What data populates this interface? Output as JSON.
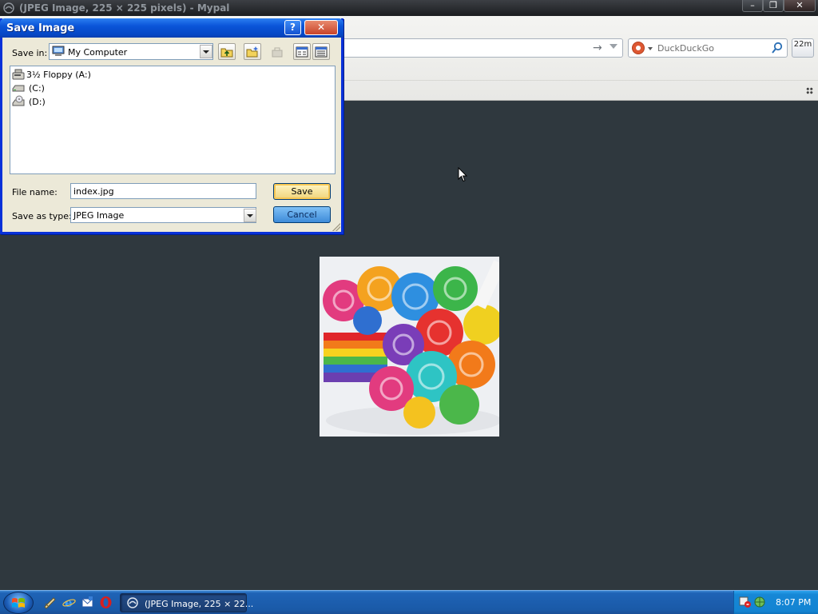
{
  "window": {
    "title": "(JPEG Image, 225 × 225 pixels) - Mypal",
    "controls": {
      "minimize": "–",
      "maximize": "❐",
      "close": "✕"
    }
  },
  "search": {
    "engine_icon": "duckduckgo-icon",
    "placeholder": "DuckDuckGo",
    "go_icon": "magnifier-icon"
  },
  "toolbar": {
    "badge": "22m",
    "go_arrow": "→"
  },
  "dialog": {
    "title": "Save Image",
    "help": "?",
    "close": "✕",
    "save_in_label": "Save in:",
    "save_in_value": "My Computer",
    "items": [
      {
        "label": "3½ Floppy (A:)",
        "icon": "floppy-drive-icon"
      },
      {
        "label": "(C:)",
        "icon": "hard-drive-icon"
      },
      {
        "label": "(D:)",
        "icon": "cd-drive-icon"
      }
    ],
    "file_name_label": "File name:",
    "file_name_value": "index.jpg",
    "save_as_type_label": "Save as type:",
    "save_as_type_value": "JPEG Image",
    "save_button": "Save",
    "cancel_button": "Cancel"
  },
  "colors": {
    "content_background": "#2f383e",
    "dialog_title": "#0a54d8",
    "taskbar": "#1f63b6"
  },
  "taskbar": {
    "task_label": "(JPEG Image, 225 × 22...",
    "clock": "8:07 PM",
    "quick_launch": [
      "media-icon",
      "ie-icon",
      "email-icon",
      "opera-icon"
    ]
  }
}
